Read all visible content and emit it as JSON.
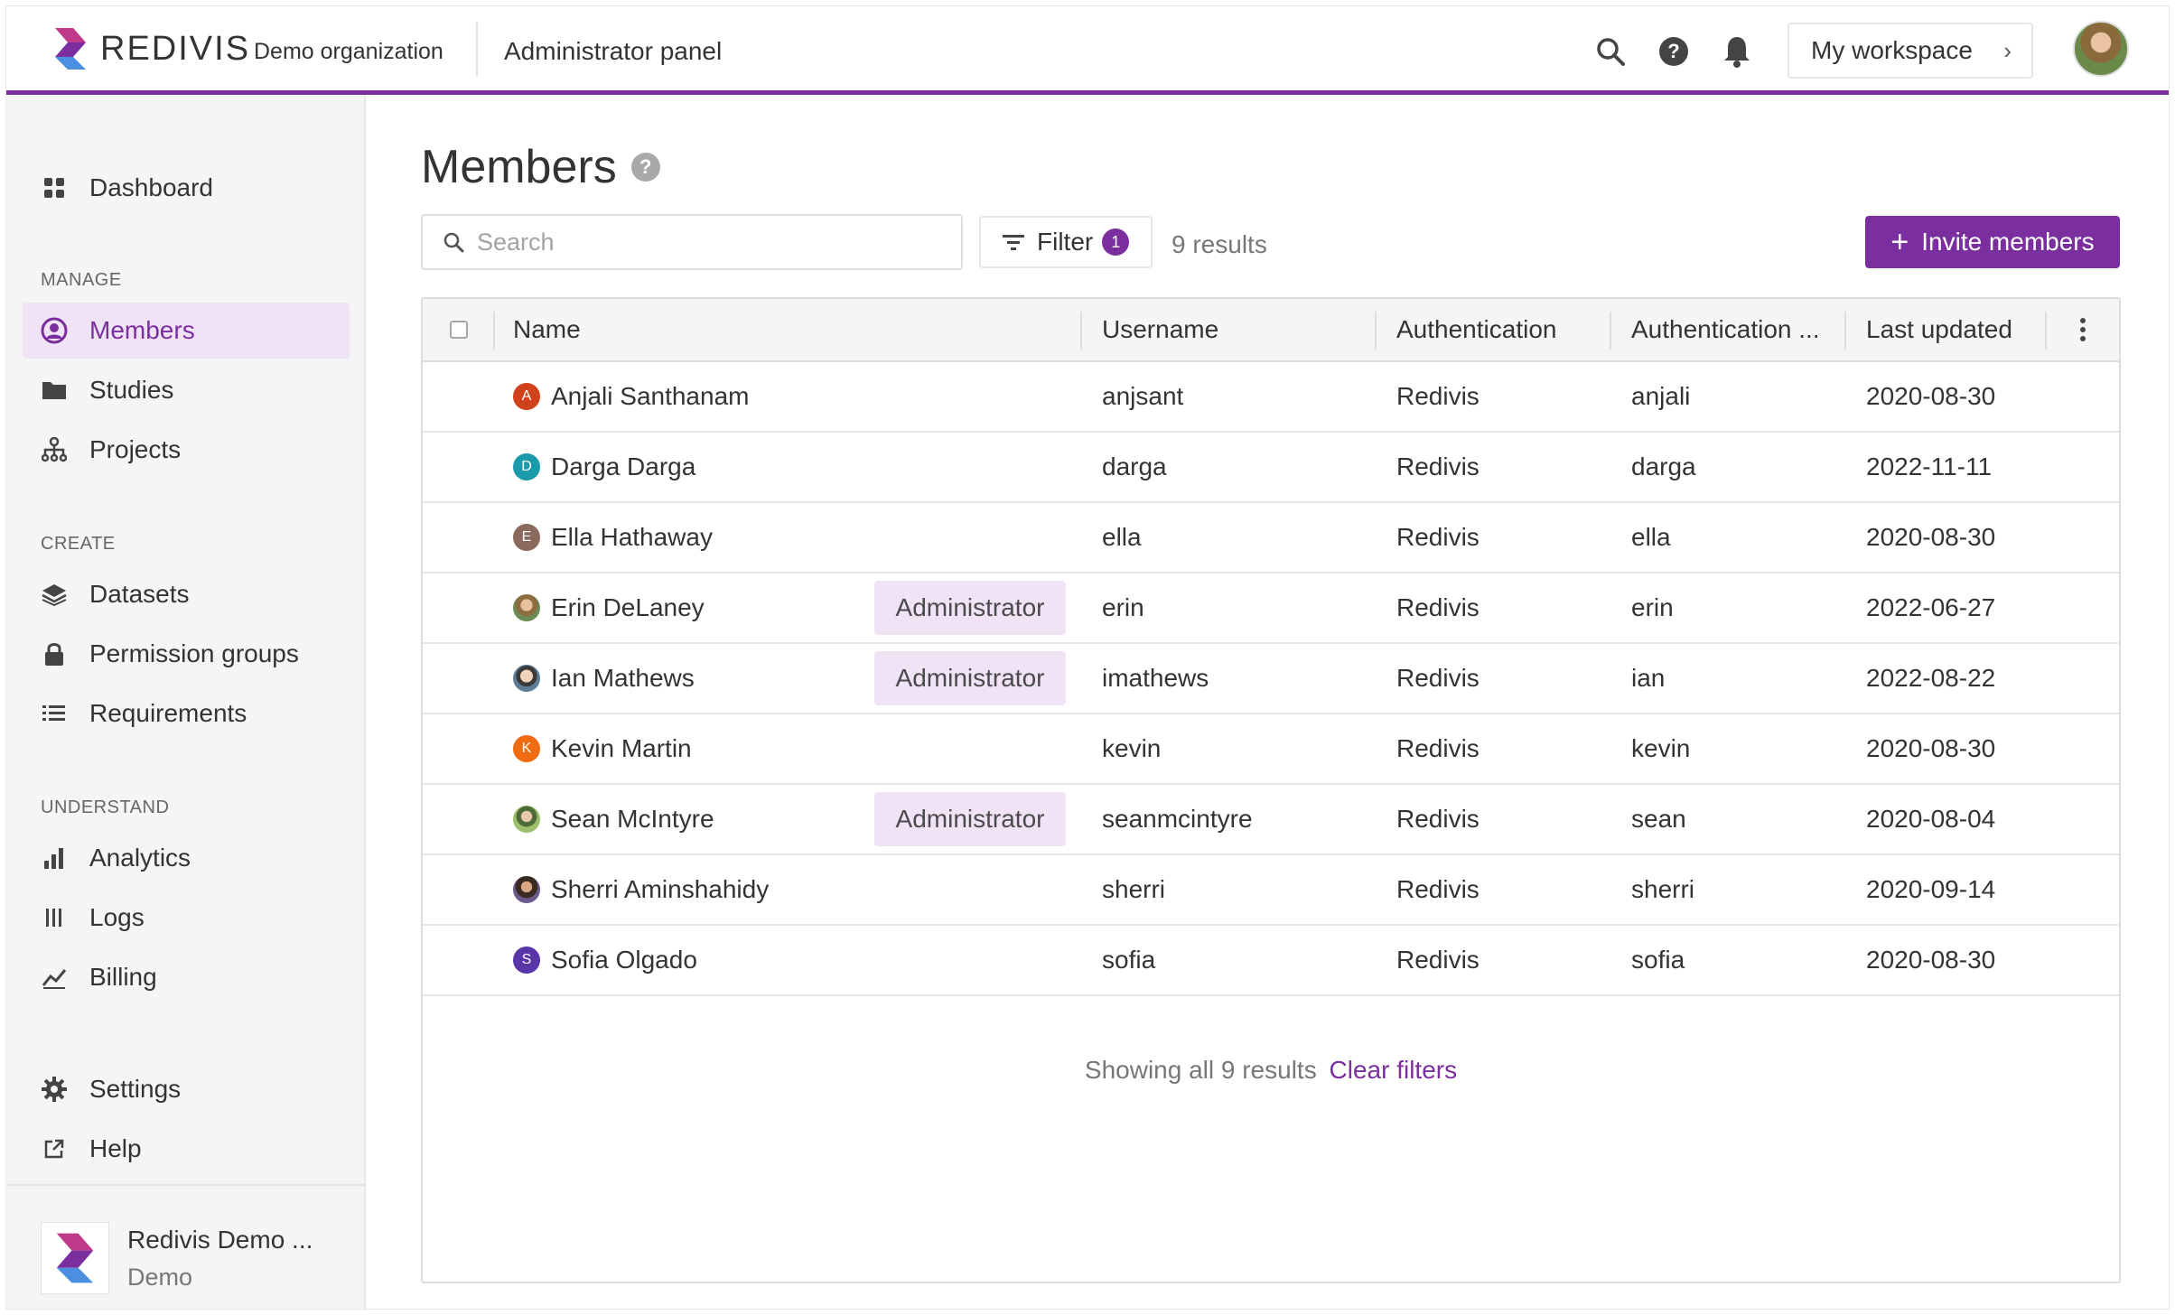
{
  "header": {
    "brand_name": "REDIVIS",
    "org_name": "Demo organization",
    "panel_title": "Administrator panel",
    "workspace_label": "My workspace",
    "accent_color": "#7b2f9e"
  },
  "sidebar": {
    "dashboard": "Dashboard",
    "sections": {
      "manage": "MANAGE",
      "create": "CREATE",
      "understand": "UNDERSTAND"
    },
    "items": {
      "members": "Members",
      "studies": "Studies",
      "projects": "Projects",
      "datasets": "Datasets",
      "permission_groups": "Permission groups",
      "requirements": "Requirements",
      "analytics": "Analytics",
      "logs": "Logs",
      "billing": "Billing",
      "settings": "Settings",
      "help": "Help"
    },
    "footer": {
      "name": "Redivis Demo ...",
      "sub": "Demo"
    }
  },
  "main": {
    "title": "Members",
    "search_placeholder": "Search",
    "filter_label": "Filter",
    "filter_count": "1",
    "results": "9 results",
    "invite_label": "Invite members",
    "columns": {
      "name": "Name",
      "username": "Username",
      "auth": "Authentication",
      "auth2": "Authentication ...",
      "updated": "Last updated"
    },
    "admin_label": "Administrator",
    "rows": [
      {
        "initial": "A",
        "name": "Anjali Santhanam",
        "username": "anjsant",
        "auth": "Redivis",
        "auth_id": "anjali",
        "updated": "2020-08-30"
      },
      {
        "initial": "D",
        "name": "Darga Darga",
        "username": "darga",
        "auth": "Redivis",
        "auth_id": "darga",
        "updated": "2022-11-11"
      },
      {
        "initial": "E",
        "name": "Ella Hathaway",
        "username": "ella",
        "auth": "Redivis",
        "auth_id": "ella",
        "updated": "2020-08-30"
      },
      {
        "initial": "",
        "name": "Erin DeLaney",
        "username": "erin",
        "auth": "Redivis",
        "auth_id": "erin",
        "updated": "2022-06-27"
      },
      {
        "initial": "",
        "name": "Ian Mathews",
        "username": "imathews",
        "auth": "Redivis",
        "auth_id": "ian",
        "updated": "2022-08-22"
      },
      {
        "initial": "K",
        "name": "Kevin Martin",
        "username": "kevin",
        "auth": "Redivis",
        "auth_id": "kevin",
        "updated": "2020-08-30"
      },
      {
        "initial": "",
        "name": "Sean McIntyre",
        "username": "seanmcintyre",
        "auth": "Redivis",
        "auth_id": "sean",
        "updated": "2020-08-04"
      },
      {
        "initial": "",
        "name": "Sherri Aminshahidy",
        "username": "sherri",
        "auth": "Redivis",
        "auth_id": "sherri",
        "updated": "2020-09-14"
      },
      {
        "initial": "S",
        "name": "Sofia Olgado",
        "username": "sofia",
        "auth": "Redivis",
        "auth_id": "sofia",
        "updated": "2020-08-30"
      }
    ],
    "footer_text": "Showing all 9 results",
    "clear_filters": "Clear filters"
  }
}
